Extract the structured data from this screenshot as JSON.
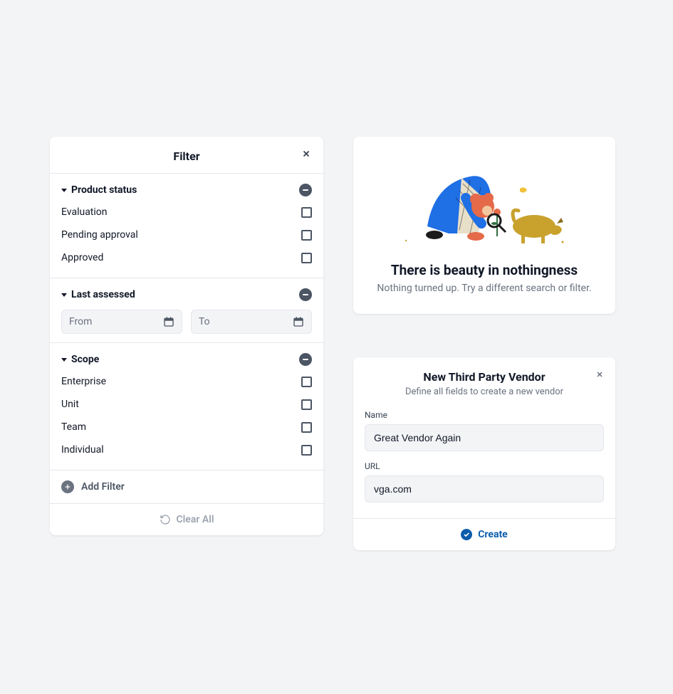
{
  "filter": {
    "title": "Filter",
    "sections": [
      {
        "title": "Product status",
        "options": [
          "Evaluation",
          "Pending approval",
          "Approved"
        ]
      },
      {
        "title": "Last assessed",
        "from_placeholder": "From",
        "to_placeholder": "To"
      },
      {
        "title": "Scope",
        "options": [
          "Enterprise",
          "Unit",
          "Team",
          "Individual"
        ]
      }
    ],
    "add_filter_label": "Add Filter",
    "clear_all_label": "Clear All"
  },
  "empty": {
    "title": "There is beauty in nothingness",
    "subtitle": "Nothing turned up. Try a different search or filter."
  },
  "vendor": {
    "title": "New Third Party Vendor",
    "subtitle": "Define all fields to create a new vendor",
    "name_label": "Name",
    "name_value": "Great Vendor Again",
    "url_label": "URL",
    "url_value": "vga.com",
    "create_label": "Create"
  }
}
